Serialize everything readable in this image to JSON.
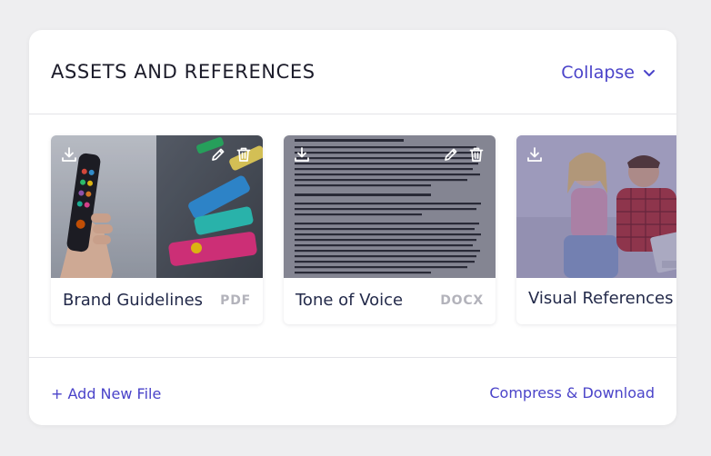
{
  "header": {
    "title": "ASSETS AND REFERENCES",
    "collapse_label": "Collapse"
  },
  "files": [
    {
      "name": "Brand Guidelines",
      "type": "PDF",
      "actions": [
        "download-icon",
        "edit-icon",
        "trash-icon"
      ]
    },
    {
      "name": "Tone of Voice",
      "type": "DOCX",
      "actions": [
        "download-icon",
        "edit-icon",
        "trash-icon"
      ]
    },
    {
      "name": "Visual References",
      "type": "",
      "actions": [
        "download-icon"
      ]
    }
  ],
  "footer": {
    "add_label": "+ Add New File",
    "compress_label": "Compress & Download"
  },
  "colors": {
    "accent": "#4a43c9",
    "title": "#1c1c2a",
    "file_name": "#232a4a",
    "file_type": "#b3b3bb"
  }
}
